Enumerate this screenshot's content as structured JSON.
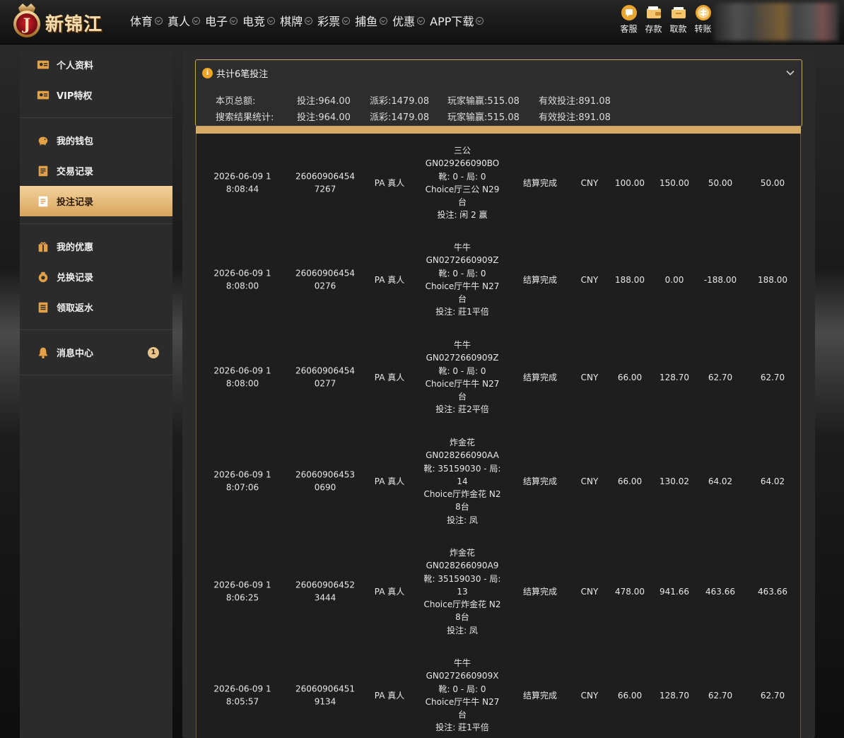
{
  "brand": {
    "name": "新锦江",
    "letter": "J"
  },
  "nav": [
    "体育",
    "真人",
    "电子",
    "电竞",
    "棋牌",
    "彩票",
    "捕鱼",
    "优惠",
    "APP下载"
  ],
  "quick": [
    {
      "label": "客服",
      "icon": "chat-icon"
    },
    {
      "label": "存款",
      "icon": "wallet-icon"
    },
    {
      "label": "取款",
      "icon": "withdraw-icon"
    },
    {
      "label": "转账",
      "icon": "transfer-icon"
    }
  ],
  "sidebar": {
    "groups": [
      [
        {
          "label": "个人资料",
          "icon": "profile-icon"
        },
        {
          "label": "VIP特权",
          "icon": "vip-icon"
        }
      ],
      [
        {
          "label": "我的钱包",
          "icon": "piggy-bank-icon"
        },
        {
          "label": "交易记录",
          "icon": "transaction-icon"
        },
        {
          "label": "投注记录",
          "icon": "bet-record-icon",
          "active": true
        }
      ],
      [
        {
          "label": "我的优惠",
          "icon": "gift-icon"
        },
        {
          "label": "兑换记录",
          "icon": "exchange-icon"
        },
        {
          "label": "领取返水",
          "icon": "rebate-icon"
        }
      ],
      [
        {
          "label": "消息中心",
          "icon": "bell-icon",
          "badge": "1"
        }
      ]
    ]
  },
  "summary": {
    "title": "共计6笔投注",
    "rows": [
      {
        "label": "本页总额:",
        "bet": "投注:964.00",
        "payout": "派彩:1479.08",
        "winloss": "玩家输赢:515.08",
        "valid": "有效投注:891.08"
      },
      {
        "label": "搜索结果统计:",
        "bet": "投注:964.00",
        "payout": "派彩:1479.08",
        "winloss": "玩家输赢:515.08",
        "valid": "有效投注:891.08"
      }
    ]
  },
  "records": [
    {
      "time": "2026-06-09 18:08:44",
      "order": "260609064547267",
      "platform": "PA 真人",
      "game": [
        "三公",
        "GN029266090BO",
        "靴: 0 - 局: 0",
        "Choice厅三公 N29台",
        "投注: 闲 2 赢"
      ],
      "status": "结算完成",
      "currency": "CNY",
      "bet": "100.00",
      "payout": "150.00",
      "winloss": "50.00",
      "valid": "50.00"
    },
    {
      "time": "2026-06-09 18:08:00",
      "order": "260609064540276",
      "platform": "PA 真人",
      "game": [
        "牛牛",
        "GN0272660909Z",
        "靴: 0 - 局: 0",
        "Choice厅牛牛 N27台",
        "投注: 莊1平倍"
      ],
      "status": "结算完成",
      "currency": "CNY",
      "bet": "188.00",
      "payout": "0.00",
      "winloss": "-188.00",
      "valid": "188.00"
    },
    {
      "time": "2026-06-09 18:08:00",
      "order": "260609064540277",
      "platform": "PA 真人",
      "game": [
        "牛牛",
        "GN0272660909Z",
        "靴: 0 - 局: 0",
        "Choice厅牛牛 N27台",
        "投注: 莊2平倍"
      ],
      "status": "结算完成",
      "currency": "CNY",
      "bet": "66.00",
      "payout": "128.70",
      "winloss": "62.70",
      "valid": "62.70"
    },
    {
      "time": "2026-06-09 18:07:06",
      "order": "260609064530690",
      "platform": "PA 真人",
      "game": [
        "炸金花",
        "GN028266090AA",
        "靴: 35159030 - 局: 14",
        "Choice厅炸金花 N28台",
        "投注: 凤"
      ],
      "status": "结算完成",
      "currency": "CNY",
      "bet": "66.00",
      "payout": "130.02",
      "winloss": "64.02",
      "valid": "64.02"
    },
    {
      "time": "2026-06-09 18:06:25",
      "order": "260609064523444",
      "platform": "PA 真人",
      "game": [
        "炸金花",
        "GN028266090A9",
        "靴: 35159030 - 局: 13",
        "Choice厅炸金花 N28台",
        "投注: 凤"
      ],
      "status": "结算完成",
      "currency": "CNY",
      "bet": "478.00",
      "payout": "941.66",
      "winloss": "463.66",
      "valid": "463.66"
    },
    {
      "time": "2026-06-09 18:05:57",
      "order": "260609064519134",
      "platform": "PA 真人",
      "game": [
        "牛牛",
        "GN0272660909X",
        "靴: 0 - 局: 0",
        "Choice厅牛牛 N27台",
        "投注: 莊1平倍"
      ],
      "status": "结算完成",
      "currency": "CNY",
      "bet": "66.00",
      "payout": "128.70",
      "winloss": "62.70",
      "valid": "62.70"
    }
  ]
}
